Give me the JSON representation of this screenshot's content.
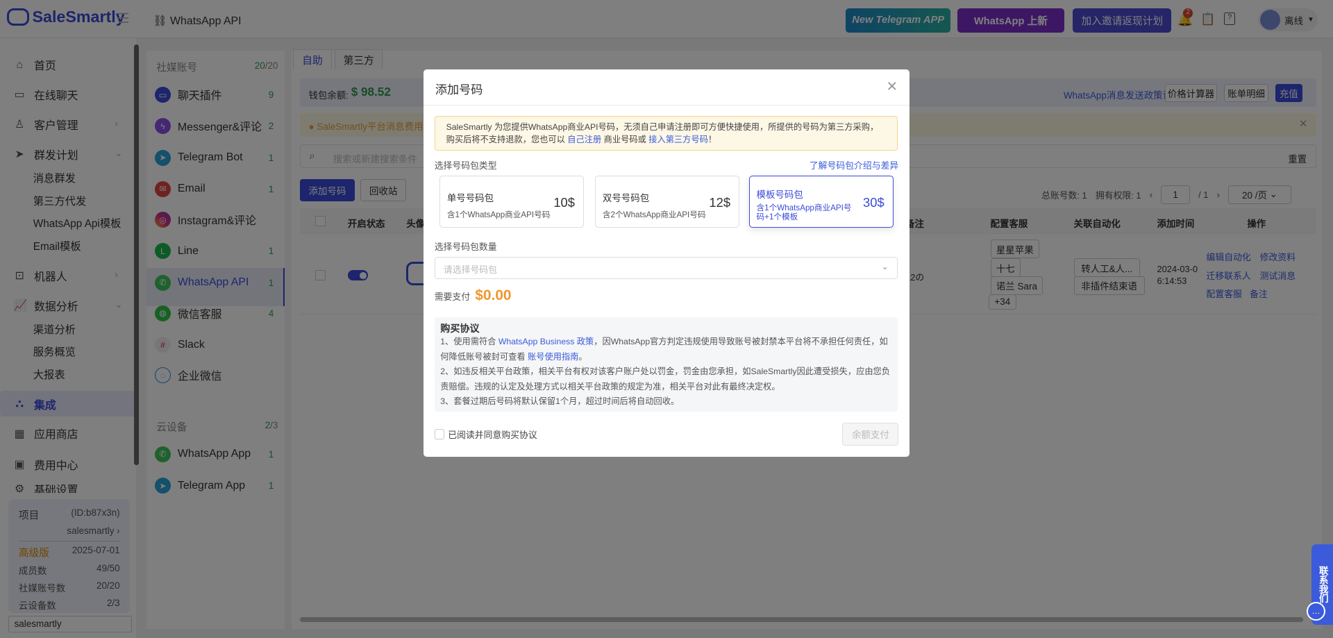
{
  "header": {
    "logo": "SaleSmartly",
    "breadcrumb": "WhatsApp API",
    "banners": [
      "New Telegram APP",
      "WhatsApp 上新",
      "加入邀请返现计划"
    ],
    "banner_new_badge": "New",
    "notification_count": "2",
    "user_status": "离线"
  },
  "sidebar": {
    "items": [
      {
        "label": "首页"
      },
      {
        "label": "在线聊天"
      },
      {
        "label": "客户管理"
      },
      {
        "label": "群发计划"
      },
      {
        "label": "机器人"
      },
      {
        "label": "数据分析"
      },
      {
        "label": "集成"
      },
      {
        "label": "应用商店"
      },
      {
        "label": "费用中心"
      },
      {
        "label": "基础设置"
      }
    ],
    "subitems_broadcast": [
      "消息群发",
      "第三方代发",
      "WhatsApp Api模板",
      "Email模板"
    ],
    "subitems_data": [
      "渠道分析",
      "服务概览",
      "大报表"
    ],
    "project": {
      "label": "项目",
      "id": "(ID:b87x3n)",
      "name": "salesmartly",
      "plan": "高级版",
      "expiry": "2025-07-01",
      "stats": [
        {
          "k": "成员数",
          "v": "49/50"
        },
        {
          "k": "社媒账号数",
          "v": "20/20"
        },
        {
          "k": "云设备数",
          "v": "2/3"
        }
      ]
    },
    "project_input": "salesmartly"
  },
  "channels": {
    "title": "社媒账号",
    "used": "20",
    "total": "/20",
    "items": [
      {
        "label": "聊天插件",
        "count": "9"
      },
      {
        "label": "Messenger&评论",
        "count": "2"
      },
      {
        "label": "Telegram Bot",
        "count": "1"
      },
      {
        "label": "Email",
        "count": "1"
      },
      {
        "label": "Instagram&评论",
        "count": ""
      },
      {
        "label": "Line",
        "count": "1"
      },
      {
        "label": "WhatsApp API",
        "count": "1"
      },
      {
        "label": "微信客服",
        "count": "4"
      },
      {
        "label": "Slack",
        "count": ""
      },
      {
        "label": "企业微信",
        "count": ""
      }
    ],
    "cloud_title": "云设备",
    "cloud_used": "2",
    "cloud_total": "/3",
    "cloud_items": [
      {
        "label": "WhatsApp App",
        "count": "1"
      },
      {
        "label": "Telegram App",
        "count": "1"
      }
    ]
  },
  "main": {
    "tabs": [
      "自助",
      "第三方"
    ],
    "wallet_label": "钱包余额:",
    "wallet_value": "$ 98.52",
    "policy_link": "WhatsApp消息发送政策说明",
    "price_calc": "价格计算器",
    "bill": "账单明细",
    "recharge": "充值",
    "notice": "SaleSmartly平台消息费用调",
    "search_placeholder": "搜索或新建搜索条件",
    "reset": "重置",
    "add_btn": "添加号码",
    "recycle_btn": "回收站",
    "pager": {
      "total": "总账号数: 1",
      "perm": "拥有权限: 1",
      "page": "1",
      "pages": "/ 1",
      "size": "20 /页"
    },
    "columns": [
      "开启状态",
      "头像",
      "备注",
      "配置客服",
      "关联自动化",
      "添加时间",
      "操作"
    ],
    "row": {
      "remark": "12の",
      "agents": [
        "星星苹果",
        "十七",
        "诺兰 Sara",
        "+34"
      ],
      "automations": [
        "转人工&人...",
        "非插件结束语"
      ],
      "time": "2024-03-0",
      "time2": "6:14:53",
      "actions": [
        "编辑自动化",
        "修改资料",
        "迁移联系人",
        "测试消息",
        "配置客服",
        "备注"
      ]
    }
  },
  "modal": {
    "title": "添加号码",
    "notice_a": "SaleSmartly 为您提供WhatsApp商业API号码，无须自己申请注册即可方便快捷使用，所提供的号码为第三方采购，购买后将不支持退款，您也可以 ",
    "notice_link1": "自己注册",
    "notice_b": " 商业号码或 ",
    "notice_link2": "接入第三方号码",
    "notice_c": "！",
    "type_label": "选择号码包类型",
    "type_link": "了解号码包介绍与差异",
    "packages": [
      {
        "name": "单号号码包",
        "desc": "含1个WhatsApp商业API号码",
        "price": "10$"
      },
      {
        "name": "双号号码包",
        "desc": "含2个WhatsApp商业API号码",
        "price": "12$"
      },
      {
        "name": "模板号码包",
        "desc": "含1个WhatsApp商业API号码+1个模板",
        "price": "30$"
      }
    ],
    "qty_label": "选择号码包数量",
    "qty_placeholder": "请选择号码包",
    "pay_label": "需要支付",
    "pay_value": "$0.00",
    "agreement_title": "购买协议",
    "a1_pre": "1、使用需符合 ",
    "a1_link": "WhatsApp Business 政策",
    "a1_mid": "，因WhatsApp官方判定违规使用导致账号被封禁本平台将不承担任何责任，如何降低账号被封可查看 ",
    "a1_link2": "账号使用指南",
    "a1_end": "。",
    "a2": "2、如违反相关平台政策，相关平台有权对该客户账户处以罚金，罚金由您承担，如SaleSmartly因此遭受损失，应由您负责赔偿。违规的认定及处理方式以相关平台政策的规定为准，相关平台对此有最终决定权。",
    "a3": "3、套餐过期后号码将默认保留1个月，超过时间后将自动回收。",
    "agree": "已阅读并同意购买协议",
    "pay_btn": "余额支付"
  },
  "contact": "联系我们"
}
